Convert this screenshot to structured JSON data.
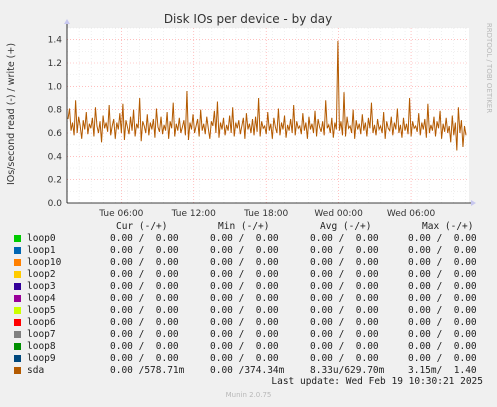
{
  "title": "Disk IOs per device - by day",
  "ylabel": "IOs/second read (-) / write (+)",
  "watermark": "RRDTOOL / TOBI OETIKER",
  "footer": "Munin 2.0.75",
  "last_update": "Last update: Wed Feb 19 10:30:21 2025",
  "legend_headers": {
    "cur": "Cur (-/+)",
    "min": "Min (-/+)",
    "avg": "Avg (-/+)",
    "max": "Max (-/+)"
  },
  "legend": [
    {
      "name": "loop0",
      "color": "#00cc00",
      "cur": "0.00 /  0.00",
      "min": "0.00 /  0.00",
      "avg": "0.00 /  0.00",
      "max": "0.00 /  0.00"
    },
    {
      "name": "loop1",
      "color": "#0066b3",
      "cur": "0.00 /  0.00",
      "min": "0.00 /  0.00",
      "avg": "0.00 /  0.00",
      "max": "0.00 /  0.00"
    },
    {
      "name": "loop10",
      "color": "#ff8000",
      "cur": "0.00 /  0.00",
      "min": "0.00 /  0.00",
      "avg": "0.00 /  0.00",
      "max": "0.00 /  0.00"
    },
    {
      "name": "loop2",
      "color": "#ffcc00",
      "cur": "0.00 /  0.00",
      "min": "0.00 /  0.00",
      "avg": "0.00 /  0.00",
      "max": "0.00 /  0.00"
    },
    {
      "name": "loop3",
      "color": "#330099",
      "cur": "0.00 /  0.00",
      "min": "0.00 /  0.00",
      "avg": "0.00 /  0.00",
      "max": "0.00 /  0.00"
    },
    {
      "name": "loop4",
      "color": "#990099",
      "cur": "0.00 /  0.00",
      "min": "0.00 /  0.00",
      "avg": "0.00 /  0.00",
      "max": "0.00 /  0.00"
    },
    {
      "name": "loop5",
      "color": "#ccff00",
      "cur": "0.00 /  0.00",
      "min": "0.00 /  0.00",
      "avg": "0.00 /  0.00",
      "max": "0.00 /  0.00"
    },
    {
      "name": "loop6",
      "color": "#ff0000",
      "cur": "0.00 /  0.00",
      "min": "0.00 /  0.00",
      "avg": "0.00 /  0.00",
      "max": "0.00 /  0.00"
    },
    {
      "name": "loop7",
      "color": "#808080",
      "cur": "0.00 /  0.00",
      "min": "0.00 /  0.00",
      "avg": "0.00 /  0.00",
      "max": "0.00 /  0.00"
    },
    {
      "name": "loop8",
      "color": "#008f00",
      "cur": "0.00 /  0.00",
      "min": "0.00 /  0.00",
      "avg": "0.00 /  0.00",
      "max": "0.00 /  0.00"
    },
    {
      "name": "loop9",
      "color": "#00487d",
      "cur": "0.00 /  0.00",
      "min": "0.00 /  0.00",
      "avg": "0.00 /  0.00",
      "max": "0.00 /  0.00"
    },
    {
      "name": "sda",
      "color": "#b35a00",
      "cur": "0.00 /578.71m",
      "min": "0.00 /374.34m",
      "avg": "8.33u/629.70m",
      "max": "3.15m/  1.40"
    }
  ],
  "colors": {
    "background": "#f0f0f0",
    "plot": "#ffffff",
    "grid_major": "#ff9999",
    "grid_minor": "#e0e0e0",
    "series": "#b35a00"
  },
  "chart_data": {
    "type": "line",
    "title": "Disk IOs per device - by day",
    "ylabel": "IOs/second read (-) / write (+)",
    "ylim": [
      0,
      1.5
    ],
    "yticks": [
      0.0,
      0.2,
      0.4,
      0.6,
      0.8,
      1.0,
      1.2,
      1.4
    ],
    "ytick_labels": [
      "0.0",
      "0.2",
      "0.4",
      "0.6",
      "0.8",
      "1.0",
      "1.2",
      "1.4"
    ],
    "x_range_hours": [
      0,
      33.3
    ],
    "xticks": [
      {
        "label": "Tue 06:00",
        "hour": 4.5
      },
      {
        "label": "Tue 12:00",
        "hour": 10.5
      },
      {
        "label": "Tue 18:00",
        "hour": 16.5
      },
      {
        "label": "Wed 00:00",
        "hour": 22.5
      },
      {
        "label": "Wed 06:00",
        "hour": 28.5
      }
    ],
    "grid": true,
    "series": [
      {
        "name": "sda",
        "color": "#b35a00",
        "values": [
          0.72,
          0.81,
          0.62,
          0.69,
          0.58,
          0.88,
          0.6,
          0.74,
          0.66,
          0.55,
          0.71,
          0.63,
          0.78,
          0.59,
          0.68,
          0.64,
          0.73,
          0.57,
          0.82,
          0.66,
          0.6,
          0.7,
          0.52,
          0.75,
          0.64,
          0.69,
          0.61,
          0.84,
          0.58,
          0.66,
          0.72,
          0.55,
          0.69,
          0.63,
          0.77,
          0.6,
          0.85,
          0.54,
          0.71,
          0.65,
          0.59,
          0.74,
          0.62,
          0.8,
          0.57,
          0.68,
          0.64,
          0.9,
          0.53,
          0.7,
          0.66,
          0.6,
          0.76,
          0.58,
          0.69,
          0.63,
          0.72,
          0.56,
          0.81,
          0.65,
          0.61,
          0.74,
          0.59,
          0.67,
          0.62,
          0.78,
          0.55,
          0.7,
          0.64,
          0.86,
          0.57,
          0.68,
          0.62,
          0.73,
          0.6,
          0.65,
          0.71,
          0.58,
          0.96,
          0.54,
          0.69,
          0.63,
          0.76,
          0.6,
          0.66,
          0.72,
          0.57,
          0.8,
          0.62,
          0.68,
          0.59,
          0.74,
          0.64,
          0.55,
          0.7,
          0.66,
          0.79,
          0.6,
          0.87,
          0.56,
          0.69,
          0.63,
          0.73,
          0.58,
          0.67,
          0.62,
          0.75,
          0.6,
          0.82,
          0.57,
          0.69,
          0.64,
          0.71,
          0.59,
          0.66,
          0.73,
          0.55,
          0.77,
          0.63,
          0.68,
          0.6,
          0.72,
          0.58,
          0.74,
          0.61,
          0.9,
          0.57,
          0.7,
          0.64,
          0.66,
          0.59,
          0.78,
          0.62,
          0.68,
          0.55,
          0.73,
          0.65,
          0.6,
          0.81,
          0.58,
          0.69,
          0.63,
          0.75,
          0.56,
          0.67,
          0.62,
          0.72,
          0.6,
          0.84,
          0.58,
          0.7,
          0.64,
          0.66,
          0.59,
          0.77,
          0.62,
          0.69,
          0.55,
          0.74,
          0.63,
          0.68,
          0.6,
          0.79,
          0.57,
          0.72,
          0.65,
          0.61,
          0.7,
          0.58,
          0.88,
          0.64,
          0.67,
          0.6,
          0.73,
          0.56,
          0.69,
          0.63,
          1.39,
          0.62,
          0.7,
          0.58,
          0.95,
          0.57,
          0.74,
          0.64,
          0.66,
          0.6,
          0.8,
          0.55,
          0.71,
          0.63,
          0.68,
          0.59,
          0.76,
          0.62,
          0.69,
          0.57,
          0.73,
          0.64,
          0.86,
          0.6,
          0.67,
          0.58,
          0.72,
          0.63,
          0.66,
          0.6,
          0.78,
          0.55,
          0.7,
          0.64,
          0.62,
          0.74,
          0.58,
          0.69,
          0.63,
          0.81,
          0.6,
          0.67,
          0.56,
          0.73,
          0.62,
          0.68,
          0.59,
          0.9,
          0.57,
          0.7,
          0.64,
          0.66,
          0.61,
          0.77,
          0.58,
          0.69,
          0.63,
          0.72,
          0.56,
          0.85,
          0.6,
          0.67,
          0.62,
          0.74,
          0.57,
          0.7,
          0.64,
          0.79,
          0.55,
          0.68,
          0.61,
          0.73,
          0.6,
          0.66,
          0.52,
          0.75,
          0.58,
          0.69,
          0.45,
          0.82,
          0.6,
          0.71,
          0.48,
          0.66,
          0.58
        ]
      }
    ]
  }
}
